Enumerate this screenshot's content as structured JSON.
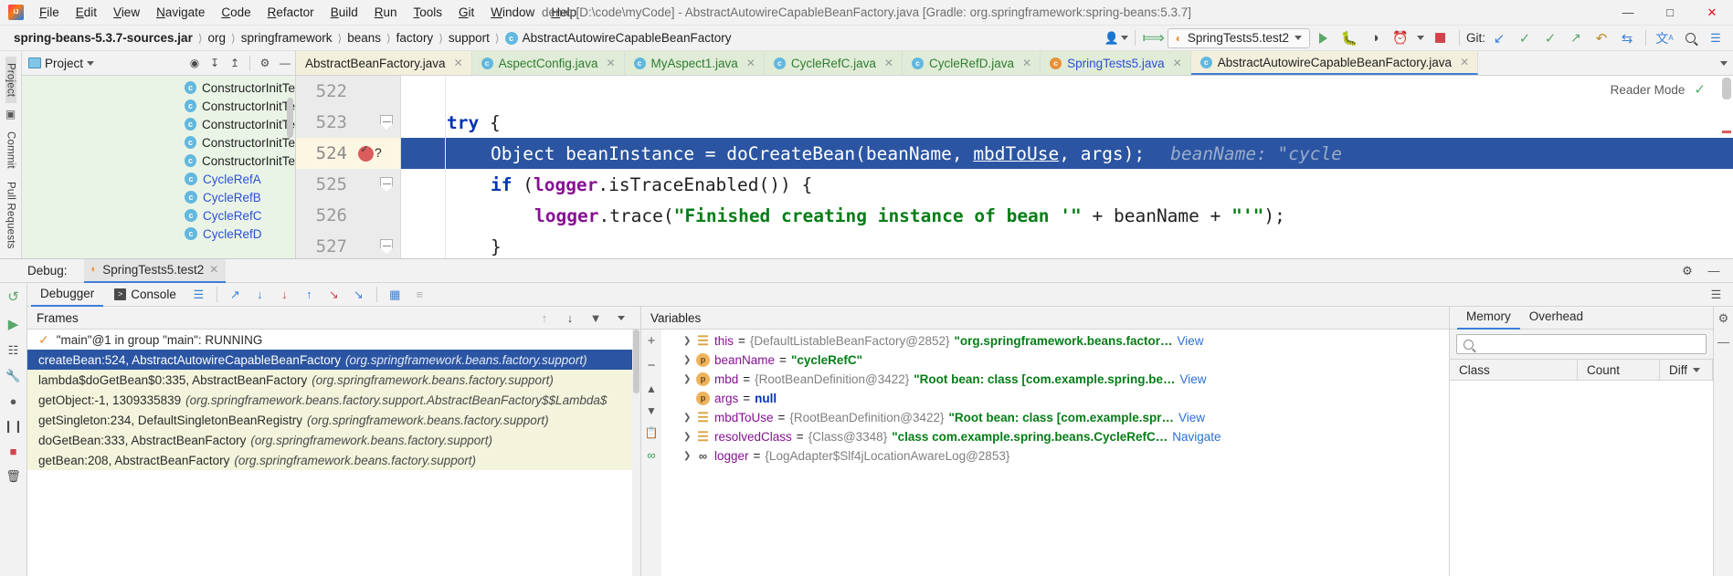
{
  "window": {
    "title": "demo [D:\\code\\myCode] - AbstractAutowireCapableBeanFactory.java [Gradle: org.springframework:spring-beans:5.3.7]",
    "minimize": "—",
    "maximize": "□",
    "close": "✕"
  },
  "menu": {
    "items": [
      {
        "label": "File"
      },
      {
        "label": "Edit"
      },
      {
        "label": "View"
      },
      {
        "label": "Navigate"
      },
      {
        "label": "Code"
      },
      {
        "label": "Refactor"
      },
      {
        "label": "Build"
      },
      {
        "label": "Run"
      },
      {
        "label": "Tools"
      },
      {
        "label": "Git"
      },
      {
        "label": "Window"
      },
      {
        "label": "Help"
      }
    ]
  },
  "navbar": {
    "crumbs": [
      {
        "label": "spring-beans-5.3.7-sources.jar",
        "bold": true
      },
      {
        "label": "org"
      },
      {
        "label": "springframework"
      },
      {
        "label": "beans"
      },
      {
        "label": "factory"
      },
      {
        "label": "support"
      },
      {
        "label": "AbstractAutowireCapableBeanFactory",
        "icon": "class-icon"
      }
    ],
    "run_config": "SpringTests5.test2",
    "git_label": "Git:"
  },
  "rail_left": {
    "project_label": "Project",
    "commit_label": "Commit",
    "pull_requests_label": "Pull Requests"
  },
  "project_tool": {
    "title": "Project",
    "tree": [
      {
        "label": "ConstructorInitTe",
        "color": "black"
      },
      {
        "label": "ConstructorInitTe",
        "color": "black"
      },
      {
        "label": "ConstructorInitTe",
        "color": "black"
      },
      {
        "label": "ConstructorInitTe",
        "color": "black"
      },
      {
        "label": "ConstructorInitTe",
        "color": "black"
      },
      {
        "label": "CycleRefA",
        "color": "blue"
      },
      {
        "label": "CycleRefB",
        "color": "blue"
      },
      {
        "label": "CycleRefC",
        "color": "blue"
      },
      {
        "label": "CycleRefD",
        "color": "blue"
      }
    ]
  },
  "editor_tabs": [
    {
      "label": "AbstractBeanFactory.java",
      "style": "yellow",
      "icon": false
    },
    {
      "label": "AspectConfig.java",
      "style": "green",
      "icon": true
    },
    {
      "label": "MyAspect1.java",
      "style": "green",
      "icon": true
    },
    {
      "label": "CycleRefC.java",
      "style": "green",
      "icon": true
    },
    {
      "label": "CycleRefD.java",
      "style": "green",
      "icon": true
    },
    {
      "label": "SpringTests5.java",
      "style": "green",
      "icon": true
    },
    {
      "label": "AbstractAutowireCapableBeanFactory.java",
      "style": "active",
      "icon": true
    }
  ],
  "editor": {
    "reader_mode": "Reader Mode",
    "lines": [
      {
        "num": "522",
        "text": "",
        "state": "blank"
      },
      {
        "num": "523",
        "text": "try {",
        "state": "fold"
      },
      {
        "num": "524",
        "text": "Object beanInstance = doCreateBean(beanName, mbdToUse, args);",
        "state": "current",
        "hint": "beanName: \"cycle"
      },
      {
        "num": "525",
        "text": "if (logger.isTraceEnabled()) {",
        "state": "fold"
      },
      {
        "num": "526",
        "text": "logger.trace(\"Finished creating instance of bean '\" + beanName + \"'\");",
        "state": "normal"
      },
      {
        "num": "527",
        "text": "}",
        "state": "fold"
      }
    ]
  },
  "debug": {
    "label": "Debug:",
    "session": "SpringTests5.test2",
    "tabs": [
      {
        "label": "Debugger",
        "active": true
      },
      {
        "label": "Console",
        "active": false
      }
    ],
    "frames": {
      "title": "Frames",
      "thread": "\"main\"@1 in group \"main\": RUNNING",
      "rows": [
        {
          "method": "createBean:524, AbstractAutowireCapableBeanFactory",
          "pkg": "(org.springframework.beans.factory.support)",
          "selected": true
        },
        {
          "method": "lambda$doGetBean$0:335, AbstractBeanFactory",
          "pkg": "(org.springframework.beans.factory.support)",
          "selected": false
        },
        {
          "method": "getObject:-1, 1309335839",
          "pkg": "(org.springframework.beans.factory.support.AbstractBeanFactory$$Lambda$",
          "selected": false
        },
        {
          "method": "getSingleton:234, DefaultSingletonBeanRegistry",
          "pkg": "(org.springframework.beans.factory.support)",
          "selected": false
        },
        {
          "method": "doGetBean:333, AbstractBeanFactory",
          "pkg": "(org.springframework.beans.factory.support)",
          "selected": false
        },
        {
          "method": "getBean:208, AbstractBeanFactory",
          "pkg": "(org.springframework.beans.factory.support)",
          "selected": false
        }
      ]
    },
    "variables": {
      "title": "Variables",
      "rows": [
        {
          "icon": "obj",
          "name": "this",
          "eq": "=",
          "ref": "{DefaultListableBeanFactory@2852}",
          "value": "\"org.springframework.beans.factor…",
          "value_kind": "str",
          "link": "View"
        },
        {
          "icon": "p",
          "name": "beanName",
          "eq": "=",
          "ref": "",
          "value": "\"cycleRefC\"",
          "value_kind": "str",
          "link": ""
        },
        {
          "icon": "p",
          "name": "mbd",
          "eq": "=",
          "ref": "{RootBeanDefinition@3422}",
          "value": "\"Root bean: class [com.example.spring.be…",
          "value_kind": "str",
          "link": "View"
        },
        {
          "icon": "p",
          "name": "args",
          "eq": "=",
          "ref": "",
          "value": "null",
          "value_kind": "null",
          "link": ""
        },
        {
          "icon": "obj",
          "name": "mbdToUse",
          "eq": "=",
          "ref": "{RootBeanDefinition@3422}",
          "value": "\"Root bean: class [com.example.spr…",
          "value_kind": "str",
          "link": "View"
        },
        {
          "icon": "obj",
          "name": "resolvedClass",
          "eq": "=",
          "ref": "{Class@3348}",
          "value": "\"class com.example.spring.beans.CycleRefC…",
          "value_kind": "str",
          "link": "Navigate"
        },
        {
          "icon": "oo",
          "name": "logger",
          "eq": "=",
          "ref": "{LogAdapter$Slf4jLocationAwareLog@2853}",
          "value": "",
          "value_kind": "none",
          "link": ""
        }
      ]
    },
    "memory": {
      "tabs": [
        {
          "label": "Memory",
          "active": true
        },
        {
          "label": "Overhead",
          "active": false
        }
      ],
      "search_placeholder": "",
      "columns": [
        {
          "label": "Class"
        },
        {
          "label": "Count"
        },
        {
          "label": "Diff"
        }
      ]
    }
  },
  "colors": {
    "accent_blue": "#2b55a2",
    "tab_underline": "#3b7dd8",
    "run_green": "#59a869",
    "stop_red": "#d0454c",
    "breakpoint_red": "#db5c5c",
    "string_green": "#067d17",
    "keyword_blue": "#0033b3",
    "field_purple": "#871094",
    "tree_bg": "#eaf4e6",
    "frames_bg": "#f4f3dc"
  }
}
